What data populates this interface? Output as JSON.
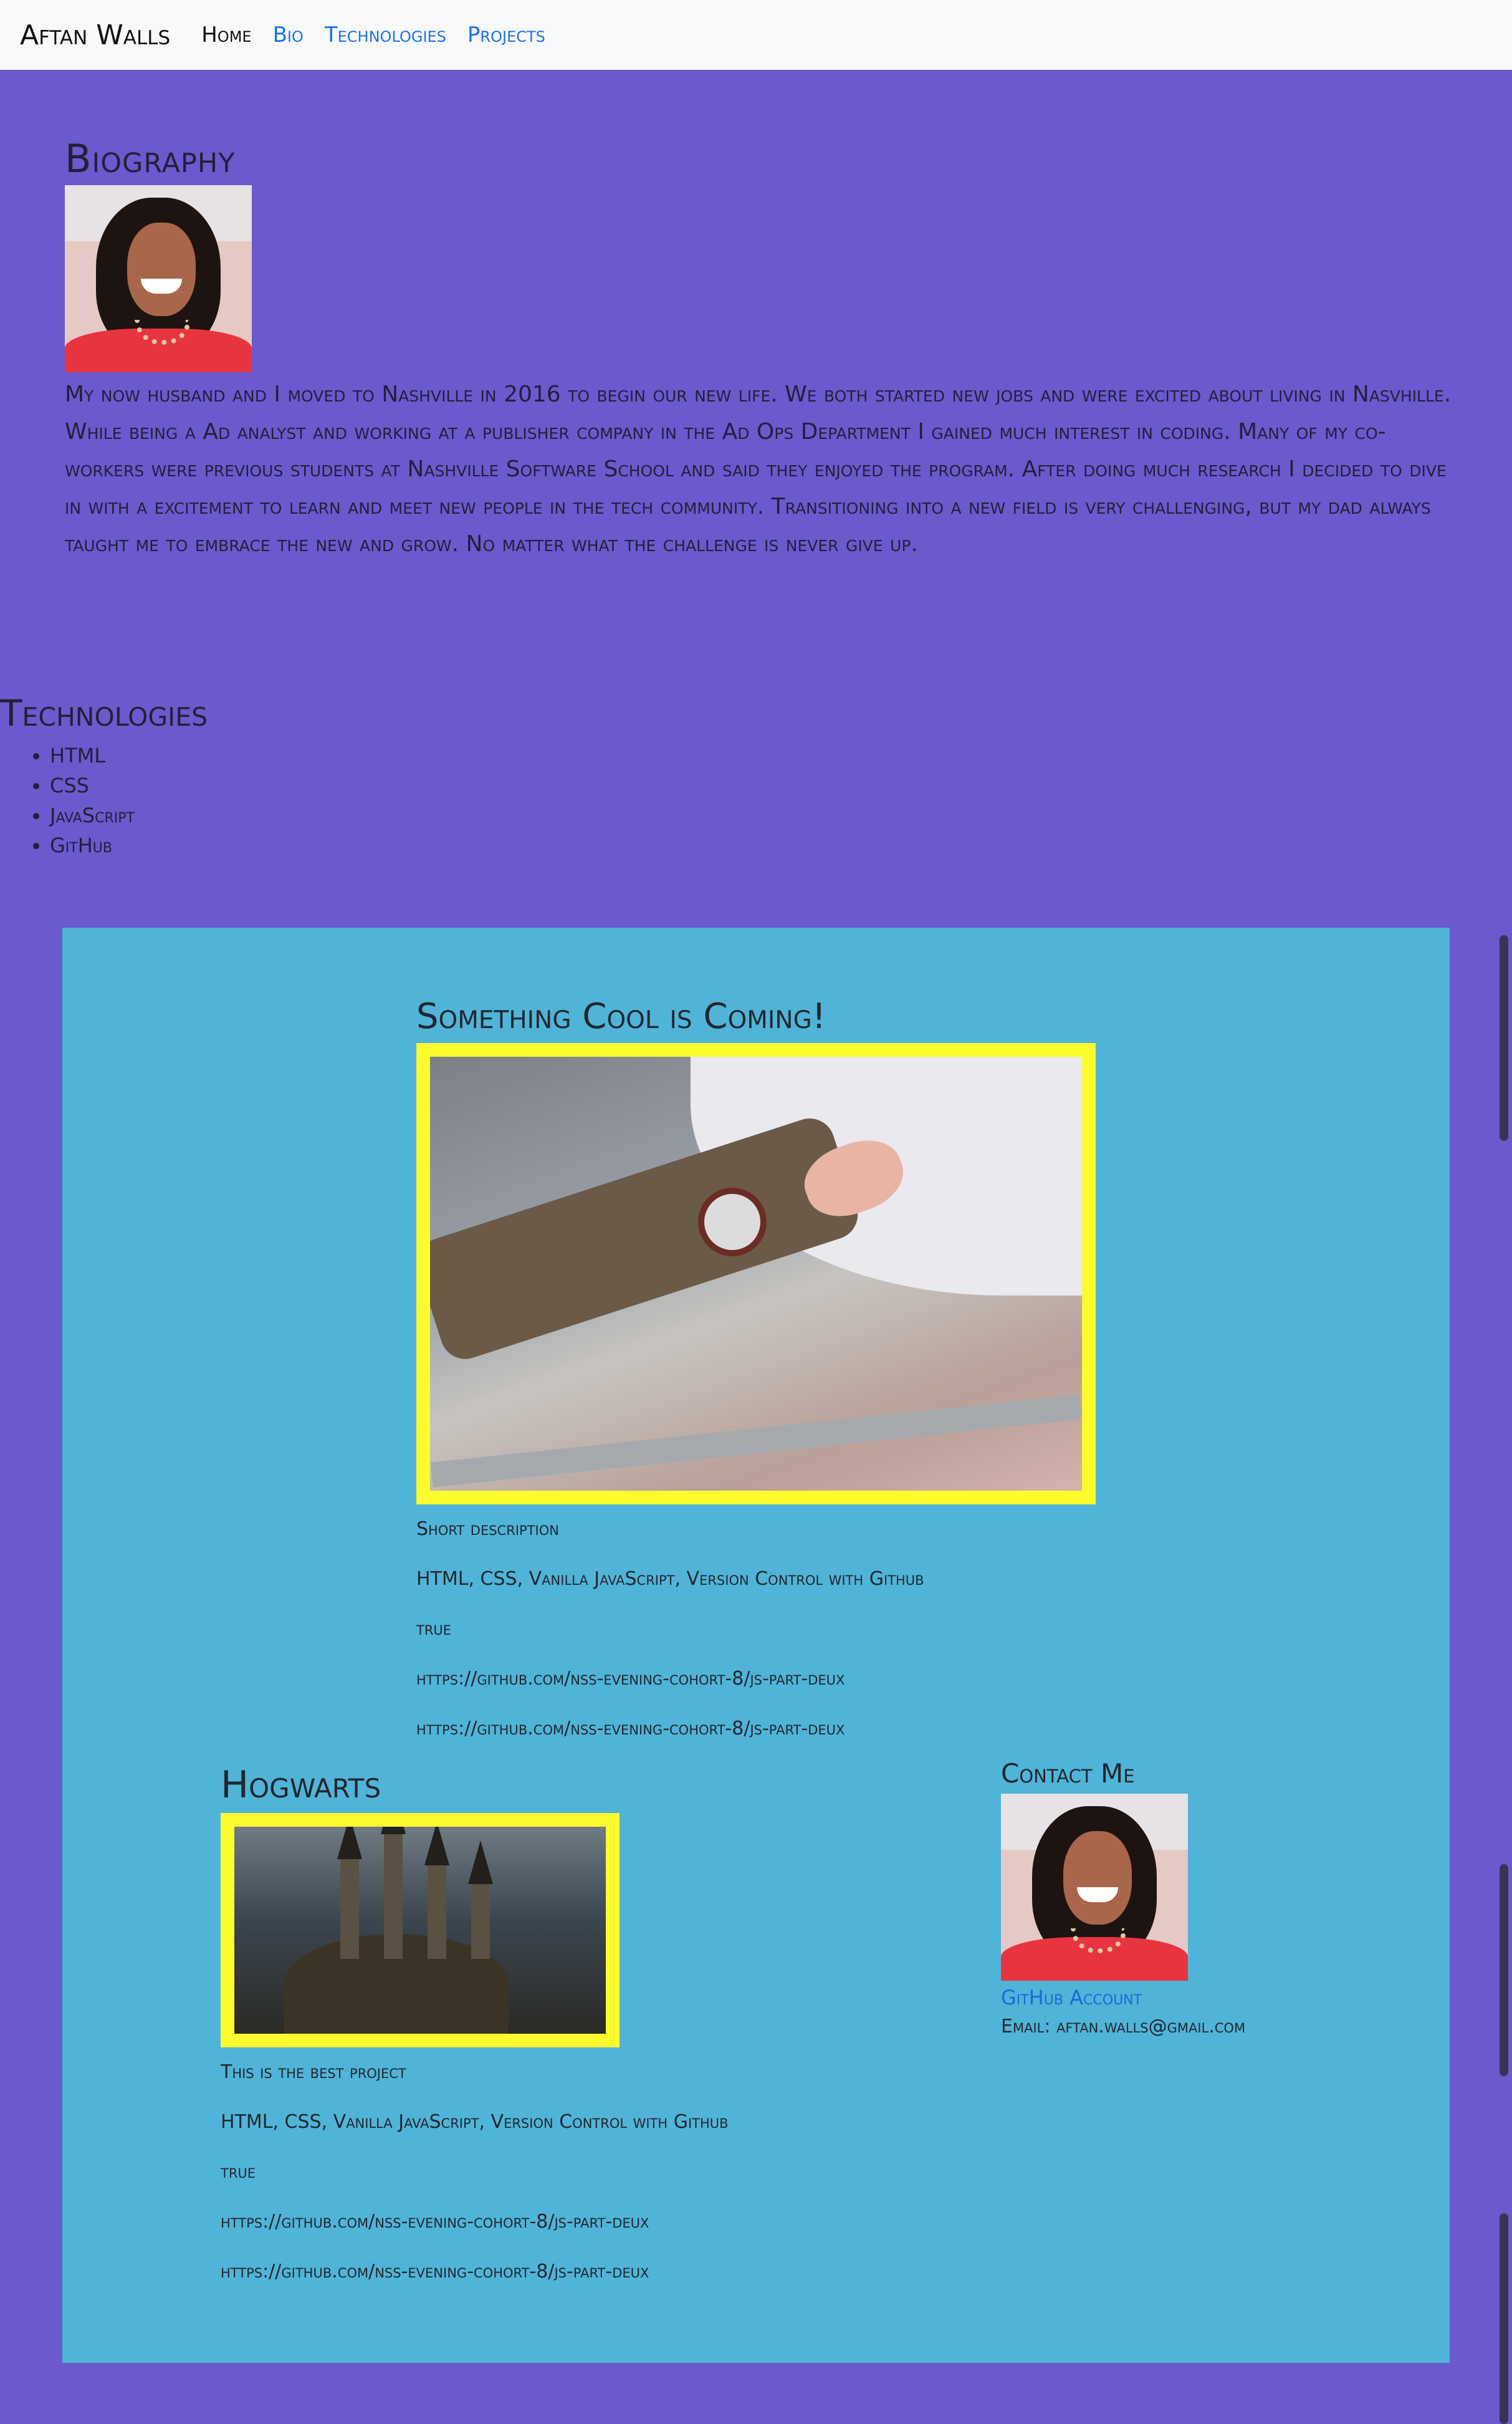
{
  "navbar": {
    "brand": "Aftan Walls",
    "links": [
      "Home",
      "Bio",
      "Technologies",
      "Projects"
    ]
  },
  "bio": {
    "title": "Biography",
    "text": "My now husband and I moved to Nashville in 2016 to begin our new life. We both started new jobs and were excited about living in Nasvhille. While being a Ad analyst and working at a publisher company in the Ad Ops Department I gained much interest in coding. Many of my co-workers were previous students at Nashville Software School and said they enjoyed the program. After doing much research I decided to dive in with a excitement to learn and meet new people in the tech community. Transitioning into a new field is very challenging, but my dad always taught me to embrace the new and grow. No matter what the challenge is never give up."
  },
  "technologies": {
    "title": "Technologies",
    "items": [
      "HTML",
      "CSS",
      "JavaScript",
      "GitHub"
    ]
  },
  "projects": [
    {
      "title": "Something Cool is Coming!",
      "description": "Short description",
      "stack": "HTML, CSS, Vanilla JavaScript, Version Control with Github",
      "flag": "true",
      "link1": "https://github.com/nss-evening-cohort-8/js-part-deux",
      "link2": "https://github.com/nss-evening-cohort-8/js-part-deux"
    },
    {
      "title": "Hogwarts",
      "description": "This is the best project",
      "stack": "HTML, CSS, Vanilla JavaScript, Version Control with Github",
      "flag": "true",
      "link1": "https://github.com/nss-evening-cohort-8/js-part-deux",
      "link2": "https://github.com/nss-evening-cohort-8/js-part-deux"
    }
  ],
  "contact": {
    "title": "Contact Me",
    "github_label": "GitHub Account",
    "email": "Email: aftan.walls@gmail.com"
  },
  "colors": {
    "page_bg": "#6a5acd",
    "panel_bg": "#4fb4d8",
    "frame": "#fbfb2e",
    "link": "#1a73e8"
  },
  "icons": [
    "profile-photo",
    "watch-photo",
    "hogwarts-photo"
  ]
}
